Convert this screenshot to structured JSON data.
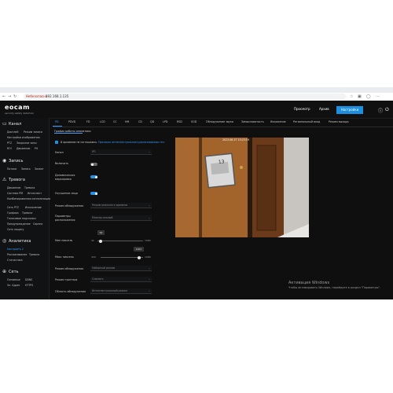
{
  "browser": {
    "security_label": "Небезопасно",
    "url": "192.168.1.135"
  },
  "header": {
    "logo": "eocam",
    "logo_sub": "security safety detection",
    "nav": [
      "Просмотр",
      "Архив",
      "Настройки"
    ],
    "active_nav": "Настройки"
  },
  "sidebar": {
    "sections": [
      {
        "title": "Канал",
        "icon": "camera-icon",
        "items": [
          "Дисплей",
          "Режим записи",
          "Наложение текста",
          "Зона",
          "Настройки изображения",
          "PTZ",
          "Закрытие зоны",
          "ROI",
          "Движение",
          "Pit"
        ]
      },
      {
        "title": "Запись",
        "icon": "record-icon",
        "items": [
          "Потоки",
          "Запись",
          "Захват"
        ]
      },
      {
        "title": "Тревога",
        "icon": "alarm-icon",
        "items": [
          "Движение",
          "Тревога",
          "Система PIR",
          "Интеллект",
          "Комбинированная сигнализация",
          "Сеть PTZ",
          "Исключение",
          "Графика",
          "Тревога",
          "Голосовые подсказки",
          "Предупреждение",
          "Сирена",
          "Сеть защиту"
        ]
      },
      {
        "title": "Аналитика",
        "icon": "analytics-icon",
        "items": [
          "Настроить 2",
          "Распознавание",
          "Тревога",
          "Статистика"
        ]
      },
      {
        "title": "Сеть",
        "icon": "network-icon",
        "items": [
          "Основные",
          "DDNS",
          "Эл. Адрес",
          "НТТРS"
        ]
      }
    ]
  },
  "tabs": [
    "PD",
    "PDVD",
    "FD",
    "LCD",
    "CC",
    "HM",
    "CD",
    "QD",
    "LPD",
    "RSD",
    "SOD",
    "Обнаружение звука",
    "Замысловатость",
    "Искажение",
    "Региональный вход",
    "Режим выхода"
  ],
  "active_tab": "PD",
  "subtab": "График работы аналитики",
  "note": {
    "text": "В архивном не соглашаюсь.",
    "link": "Протокол интеллектуального распознавания тел."
  },
  "form": {
    "channel_label": "Канал",
    "channel_value": "IP1",
    "enable_label": "Включить",
    "enable_on": false,
    "dynamic_label": "Динамическая маркировка",
    "dynamic_on": true,
    "face_label": "Улучшение лица",
    "face_on": true,
    "mode_label": "Режим обнаружения",
    "mode_value": "Режим реального времени",
    "params_label": "Параметры расположения",
    "params_value": "Многоугольный",
    "min_label": "Мин пиксель",
    "min_value": 64,
    "min_range": [
      "32",
      "1080"
    ],
    "max_label": "Макс пиксель",
    "max_value": 1007,
    "max_range": [
      "320",
      "1080"
    ],
    "detect_mode_label": "Режим обнаружения",
    "detect_mode_value": "Наборный режим",
    "trigger_label": "Режим триггера",
    "trigger_value": "Снимать",
    "area_label": "Область обнаружения",
    "area_value": "Интеллектуальный режим"
  },
  "video": {
    "timestamp": "2023-06-27 15:23:19"
  },
  "watermark": {
    "line1": "Активация Windows",
    "line2": "Чтобы активировать Windows, перейдите в раздел \"Параметры\"."
  }
}
